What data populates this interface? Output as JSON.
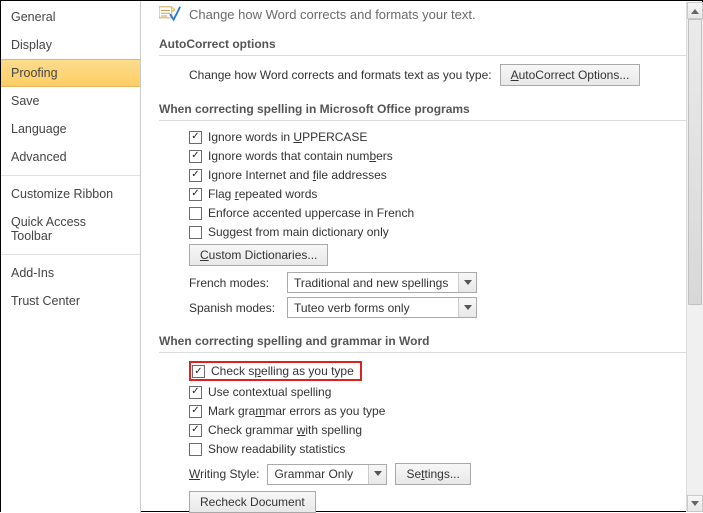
{
  "sidebar": {
    "items": [
      {
        "label": "General"
      },
      {
        "label": "Display"
      },
      {
        "label": "Proofing",
        "selected": true
      },
      {
        "label": "Save"
      },
      {
        "label": "Language"
      },
      {
        "label": "Advanced"
      },
      {
        "label": "Customize Ribbon"
      },
      {
        "label": "Quick Access Toolbar"
      },
      {
        "label": "Add-Ins"
      },
      {
        "label": "Trust Center"
      }
    ]
  },
  "header": {
    "text": "Change how Word corrects and formats your text."
  },
  "sec_autocorrect": {
    "title": "AutoCorrect options",
    "desc": "Change how Word corrects and formats text as you type:",
    "button": "AutoCorrect Options..."
  },
  "sec_spelloffice": {
    "title": "When correcting spelling in Microsoft Office programs",
    "c1": "Ignore words in UPPERCASE",
    "c2": "Ignore words that contain numbers",
    "c3": "Ignore Internet and file addresses",
    "c4": "Flag repeated words",
    "c5": "Enforce accented uppercase in French",
    "c6": "Suggest from main dictionary only",
    "btn_dict": "Custom Dictionaries...",
    "french_label": "French modes:",
    "french_value": "Traditional and new spellings",
    "spanish_label": "Spanish modes:",
    "spanish_value": "Tuteo verb forms only"
  },
  "sec_spellword": {
    "title": "When correcting spelling and grammar in Word",
    "c1": "Check spelling as you type",
    "c2": "Use contextual spelling",
    "c3": "Mark grammar errors as you type",
    "c4": "Check grammar with spelling",
    "c5": "Show readability statistics",
    "ws_label": "Writing Style:",
    "ws_value": "Grammar Only",
    "btn_settings": "Settings...",
    "btn_recheck": "Recheck Document"
  }
}
